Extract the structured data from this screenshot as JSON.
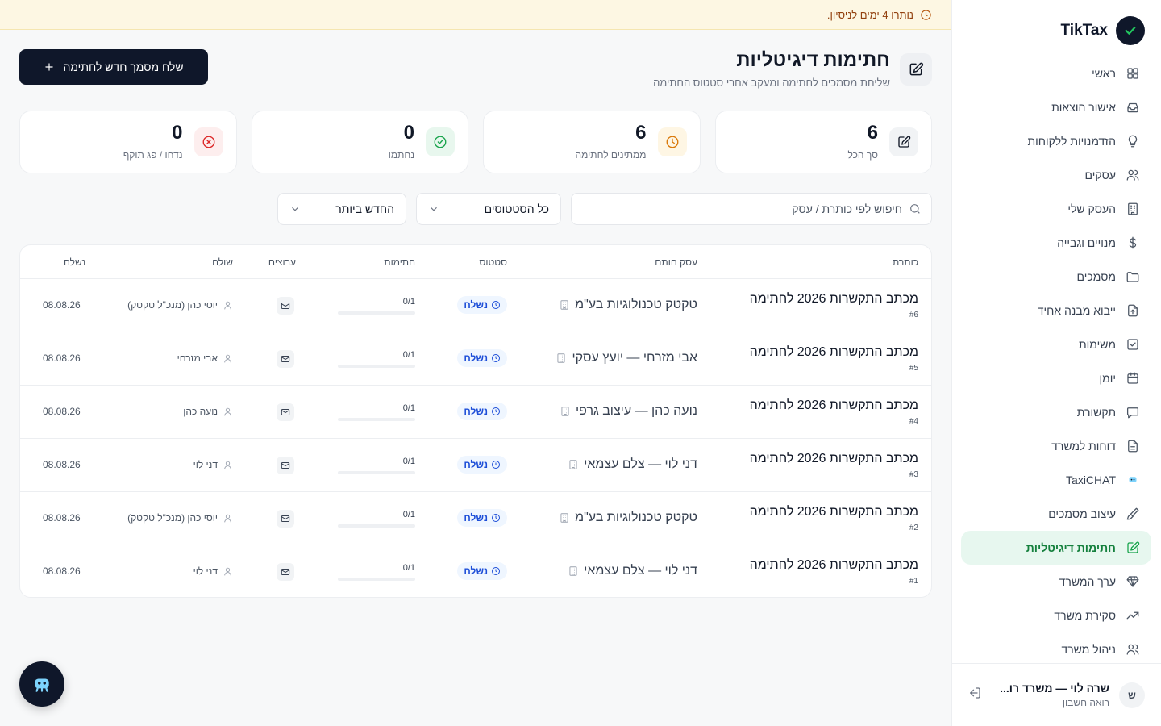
{
  "brand": {
    "name": "TikTax"
  },
  "trial_banner": {
    "text": "נותרו 4 ימים לניסיון."
  },
  "sidebar": {
    "items": [
      {
        "label": "ראשי",
        "icon": "dashboard-icon"
      },
      {
        "label": "אישור הוצאות",
        "icon": "inbox-icon"
      },
      {
        "label": "הזדמנויות ללקוחות",
        "icon": "lightbulb-icon"
      },
      {
        "label": "עסקים",
        "icon": "users-icon"
      },
      {
        "label": "העסק שלי",
        "icon": "building-icon"
      },
      {
        "label": "מנויים וגבייה",
        "icon": "dollar-icon"
      },
      {
        "label": "מסמכים",
        "icon": "folder-icon"
      },
      {
        "label": "ייבוא מבנה אחיד",
        "icon": "file-upload-icon"
      },
      {
        "label": "משימות",
        "icon": "checkbox-icon"
      },
      {
        "label": "יומן",
        "icon": "calendar-icon"
      },
      {
        "label": "תקשורת",
        "icon": "chat-icon"
      },
      {
        "label": "דוחות למשרד",
        "icon": "report-icon"
      },
      {
        "label": "TaxiCHAT",
        "icon": "bot-icon"
      },
      {
        "label": "עיצוב מסמכים",
        "icon": "brush-icon"
      },
      {
        "label": "חתימות דיגיטליות",
        "icon": "signature-icon",
        "active": true
      },
      {
        "label": "ערך המשרד",
        "icon": "diamond-icon"
      },
      {
        "label": "סקירת משרד",
        "icon": "trending-icon"
      },
      {
        "label": "ניהול משרד",
        "icon": "team-icon"
      }
    ],
    "user": {
      "initial": "ש",
      "name": "שרה לוי — משרד רו...",
      "role": "רואה חשבון"
    }
  },
  "page": {
    "title": "חתימות דיגיטליות",
    "subtitle": "שליחת מסמכים לחתימה ומעקב אחרי סטטוס החתימה",
    "primary_button": "שלח מסמך חדש לחתימה"
  },
  "stats": [
    {
      "value": "6",
      "label": "סך הכל",
      "icon": "signature-icon",
      "color": "#111827",
      "bg": "#f1f3f5"
    },
    {
      "value": "6",
      "label": "ממתינים לחתימה",
      "icon": "clock-icon",
      "color": "#d97706",
      "bg": "#fef6e4"
    },
    {
      "value": "0",
      "label": "נחתמו",
      "icon": "check-circle-icon",
      "color": "#16a34a",
      "bg": "#e8f7ee"
    },
    {
      "value": "0",
      "label": "נדחו / פג תוקף",
      "icon": "x-circle-icon",
      "color": "#dc2626",
      "bg": "#fdeeee"
    }
  ],
  "filters": {
    "search_placeholder": "חיפוש לפי כותרת / עסק",
    "status_select": "כל הסטטוסים",
    "sort_select": "החדש ביותר"
  },
  "table": {
    "headers": {
      "title": "כותרת",
      "business": "עסק חותם",
      "status": "סטטוס",
      "signatures": "חתימות",
      "channels": "ערוצים",
      "sender": "שולח",
      "sent": "נשלח"
    },
    "rows": [
      {
        "title": "מכתב התקשרות 2026 לחתימה",
        "num": "#6",
        "business": "טקטק טכנולוגיות בע\"מ",
        "status": "נשלח",
        "signatures": "0/1",
        "progress": 0,
        "sender": "יוסי כהן (מנכ\"ל טקטק)",
        "sent": "08.08.26"
      },
      {
        "title": "מכתב התקשרות 2026 לחתימה",
        "num": "#5",
        "business": "אבי מזרחי — יועץ עסקי",
        "status": "נשלח",
        "signatures": "0/1",
        "progress": 0,
        "sender": "אבי מזרחי",
        "sent": "08.08.26"
      },
      {
        "title": "מכתב התקשרות 2026 לחתימה",
        "num": "#4",
        "business": "נועה כהן — עיצוב גרפי",
        "status": "נשלח",
        "signatures": "0/1",
        "progress": 0,
        "sender": "נועה כהן",
        "sent": "08.08.26"
      },
      {
        "title": "מכתב התקשרות 2026 לחתימה",
        "num": "#3",
        "business": "דני לוי — צלם עצמאי",
        "status": "נשלח",
        "signatures": "0/1",
        "progress": 0,
        "sender": "דני לוי",
        "sent": "08.08.26"
      },
      {
        "title": "מכתב התקשרות 2026 לחתימה",
        "num": "#2",
        "business": "טקטק טכנולוגיות בע\"מ",
        "status": "נשלח",
        "signatures": "0/1",
        "progress": 0,
        "sender": "יוסי כהן (מנכ\"ל טקטק)",
        "sent": "08.08.26"
      },
      {
        "title": "מכתב התקשרות 2026 לחתימה",
        "num": "#1",
        "business": "דני לוי — צלם עצמאי",
        "status": "נשלח",
        "signatures": "0/1",
        "progress": 0,
        "sender": "דני לוי",
        "sent": "08.08.26"
      }
    ]
  },
  "colors": {
    "accent": "#16a34a",
    "primary": "#0f172a",
    "status_sent": "#1d4ed8"
  }
}
